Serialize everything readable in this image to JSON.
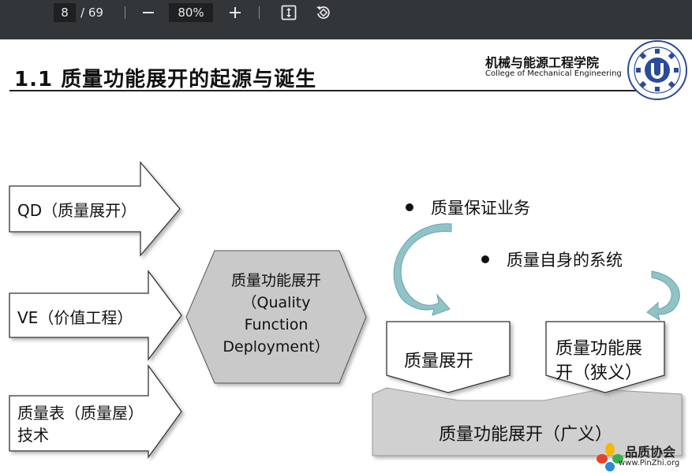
{
  "toolbar": {
    "current_page": "8",
    "page_total": "/ 69",
    "zoom": "80%",
    "icons": [
      "minus-icon",
      "plus-icon",
      "fit-page-icon",
      "rotate-icon"
    ]
  },
  "slide": {
    "title": "1.1  质量功能展开的起源与诞生",
    "college_cn": "机械与能源工程学院",
    "college_en": "College of Mechanical Engineering"
  },
  "diagram": {
    "inputs": [
      {
        "label": "QD（质量展开）"
      },
      {
        "label": "VE（价值工程）"
      },
      {
        "label_line1": "质量表（质量屋）",
        "label_line2": "技术"
      }
    ],
    "hexagon": {
      "line1": "质量功能展开",
      "line2": "（Quality",
      "line3": "Function",
      "line4": "Deployment）"
    },
    "bullets": [
      "质量保证业务",
      "质量自身的系统"
    ],
    "boxes": {
      "left": "质量展开",
      "right_line1": "质量功能展",
      "right_line2": "开（狭义）",
      "base": "质量功能展开（广义）"
    },
    "colors": {
      "arrow_teal": "#8fc3c8",
      "base_gray": "#d0d0d0",
      "stroke": "#333333"
    }
  },
  "watermark": {
    "cn": "品质协会",
    "en": "www.PinZhi.org"
  }
}
